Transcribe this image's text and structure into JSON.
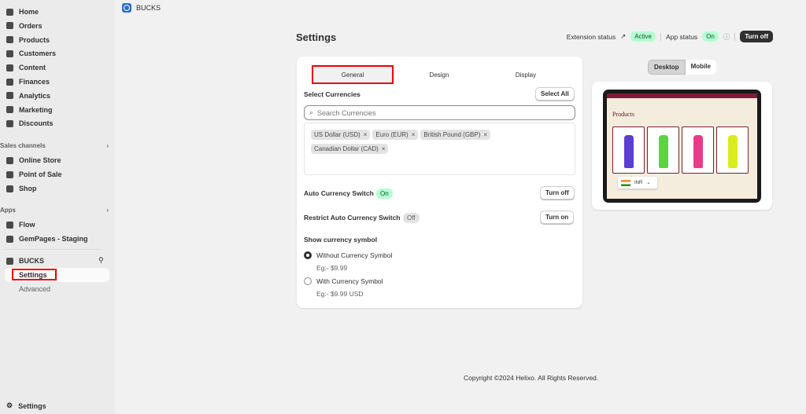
{
  "sidebar": {
    "items": [
      "Home",
      "Orders",
      "Products",
      "Customers",
      "Content",
      "Finances",
      "Analytics",
      "Marketing",
      "Discounts"
    ],
    "sales_channels_label": "Sales channels",
    "sales_channels": [
      "Online Store",
      "Point of Sale",
      "Shop"
    ],
    "apps_label": "Apps",
    "apps": [
      "Flow",
      "GemPages - Staging"
    ],
    "app_name": "BUCKS",
    "app_sub": [
      "Settings",
      "Advanced"
    ],
    "footer": "Settings"
  },
  "topbar": {
    "app": "BUCKS"
  },
  "page": {
    "title": "Settings",
    "extension_status_label": "Extension status",
    "extension_status": "Active",
    "app_status_label": "App status",
    "app_status": "On",
    "turn_off": "Turn off"
  },
  "tabs": [
    "General",
    "Design",
    "Display"
  ],
  "currencies": {
    "label": "Select Currencies",
    "select_all": "Select All",
    "placeholder": "Search Currencies",
    "selected": [
      "US Dollar (USD)",
      "Euro (EUR)",
      "British Pound (GBP)",
      "Canadian Dollar (CAD)"
    ]
  },
  "auto_switch": {
    "label": "Auto Currency Switch",
    "status": "On",
    "button": "Turn off"
  },
  "restrict_switch": {
    "label": "Restrict Auto Currency Switch",
    "status": "Off",
    "button": "Turn on"
  },
  "symbol": {
    "label": "Show currency symbol",
    "options": [
      {
        "label": "Without Currency Symbol",
        "example": "Eg:- $9.99",
        "selected": true
      },
      {
        "label": "With Currency Symbol",
        "example": "Eg:- $9.99 USD",
        "selected": false
      }
    ]
  },
  "preview": {
    "toggle": [
      "Desktop",
      "Mobile"
    ],
    "active": "Desktop",
    "store_heading": "Products",
    "currency": "INR",
    "bottle_colors": [
      "#5b3fd0",
      "#5fd33a",
      "#e83c8a",
      "#d8ec1f"
    ]
  },
  "footer": {
    "copyright": "Copyright ©2024 Helixo. All Rights Reserved."
  }
}
